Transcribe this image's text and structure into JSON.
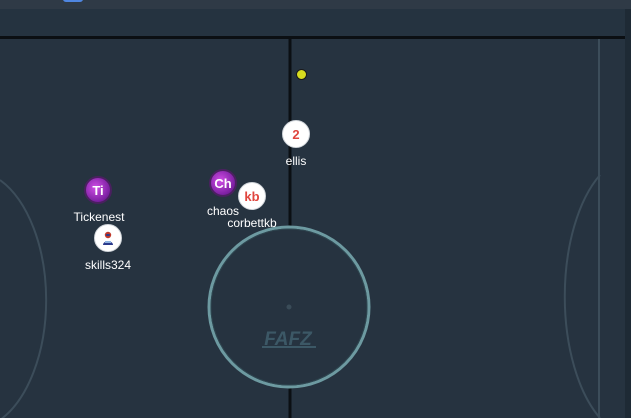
{
  "rink": {
    "center_logo": "FAFZ",
    "colors": {
      "ice": "#263340",
      "lines": "#3c4d5a",
      "center_circle": "#6d9aa1",
      "center_line": "#0b0f13",
      "puck": "#d7dc1f"
    }
  },
  "puck": {
    "icon": "puck-icon"
  },
  "players": [
    {
      "name": "ellis",
      "badge": "2",
      "style": "white"
    },
    {
      "name": "Tickenest",
      "badge": "Ti",
      "style": "purple"
    },
    {
      "name": "chaos",
      "badge": "Ch",
      "style": "purple"
    },
    {
      "name": "corbettkb",
      "badge": "kb",
      "style": "white"
    },
    {
      "name": "skills324",
      "badge": "",
      "style": "white",
      "icon": "person-icon"
    }
  ]
}
